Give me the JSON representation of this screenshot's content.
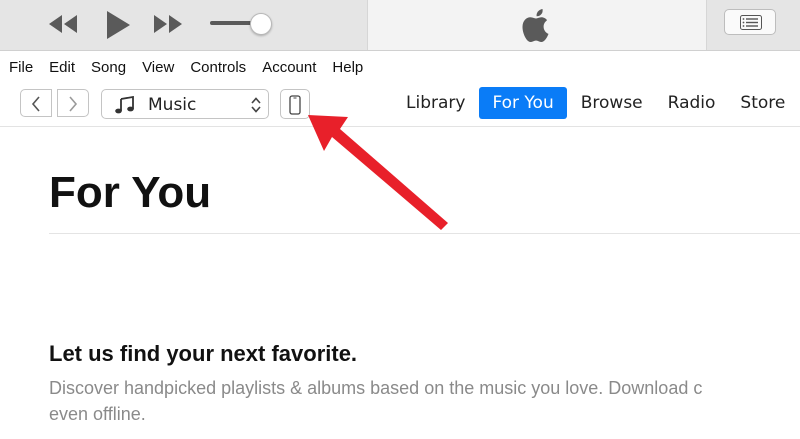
{
  "player": {
    "icons": [
      "rewind-icon",
      "play-icon",
      "fast-forward-icon",
      "volume-slider",
      "apple-logo",
      "list-icon"
    ],
    "volume_level": 0.85
  },
  "menu": {
    "items": [
      "File",
      "Edit",
      "Song",
      "View",
      "Controls",
      "Account",
      "Help"
    ]
  },
  "nav": {
    "media_kind": "Music",
    "tabs": [
      {
        "label": "Library",
        "active": false
      },
      {
        "label": "For You",
        "active": true
      },
      {
        "label": "Browse",
        "active": false
      },
      {
        "label": "Radio",
        "active": false
      },
      {
        "label": "Store",
        "active": false
      }
    ]
  },
  "content": {
    "title": "For You",
    "promo_heading": "Let us find your next favorite.",
    "promo_body_line1": "Discover handpicked playlists & albums based on the music you love. Download c",
    "promo_body_line2": "even offline."
  },
  "colors": {
    "accent": "#0a7cf7",
    "annotation_arrow": "#e8202a"
  }
}
